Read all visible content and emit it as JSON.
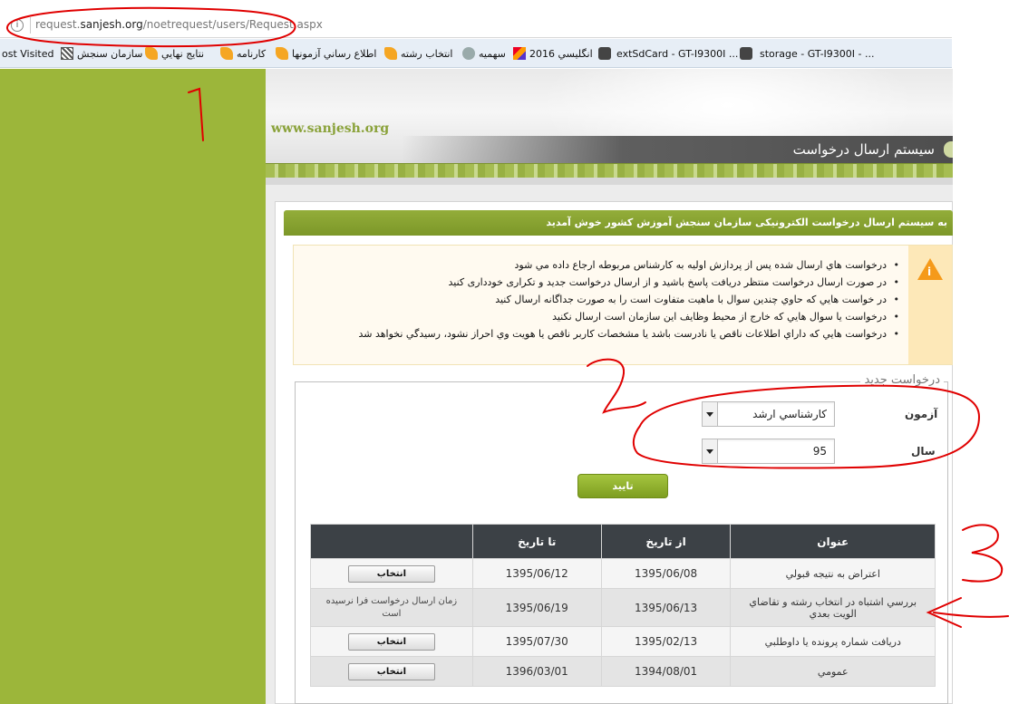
{
  "browser": {
    "url_prefix": "request.",
    "url_domain": "sanjesh.org",
    "url_path": "/noetrequest/users/Request.aspx",
    "bookmarks": [
      "ost Visited",
      "سازمان سنجش",
      "نتايج نهايي",
      "کارنامه",
      "اطلاع رساني آزمونها",
      "انتخاب رشته",
      "سهميه",
      "2016 انگليسي",
      "extSdCard - GT-I9300I ...",
      "storage - GT-I9300I - ..."
    ]
  },
  "header": {
    "site_url": "www.sanjesh.org",
    "title": "سیستم ارسال درخواست"
  },
  "welcome": "به سیستم ارسال درخواست الکترونیکی سازمان سنجش آموزش کشور خوش آمدید",
  "notices": [
    "درخواست هاي ارسال شده پس از پردازش اوليه به کارشناس مربوطه ارجاع داده مي شود",
    "در صورت ارسال درخواست منتظر دریافت پاسخ باشید و از ارسال درخواست جدید و تکراری خودداری کنید",
    "در خواست هايي که حاوي چندين سوال با ماهيت متفاوت است را به صورت جداگانه ارسال کنيد",
    "درخواست يا سوال هايي که خارج از محيط وظايف اين سازمان است ارسال نکنيد",
    "درخواست هايي که داراي اطلاعات ناقص يا نادرست باشد يا مشخصات کاربر ناقص يا هويت وي احراز نشود، رسيدگي نخواهد شد"
  ],
  "form": {
    "legend": "درخواست جدید",
    "exam_label": "آزمون",
    "exam_value": "کارشناسي ارشد",
    "year_label": "سال",
    "year_value": "95",
    "confirm_label": "تایید"
  },
  "table": {
    "headers": [
      "عنوان",
      "از تاریخ",
      "تا تاریخ",
      ""
    ],
    "rows": [
      {
        "title": "اعتراض به نتيجه قبولي",
        "from": "1395/06/08",
        "to": "1395/06/12",
        "action": "انتخاب"
      },
      {
        "title": "بررسي اشتباه در انتخاب رشته و تقاضاي الويت بعدي",
        "from": "1395/06/13",
        "to": "1395/06/19",
        "action": "زمان ارسال درخواست فرا نرسيده است"
      },
      {
        "title": "دريافت شماره پرونده يا داوطلبي",
        "from": "1395/02/13",
        "to": "1395/07/30",
        "action": "انتخاب"
      },
      {
        "title": "عمومي",
        "from": "1394/08/01",
        "to": "1396/03/01",
        "action": "انتخاب"
      }
    ]
  },
  "annotations": [
    "1",
    "2",
    "3"
  ],
  "colors": {
    "sidebar_green": "#9cb63a",
    "header_green": "#7c9728",
    "table_header": "#3c4146",
    "annotation_red": "#e00000"
  }
}
